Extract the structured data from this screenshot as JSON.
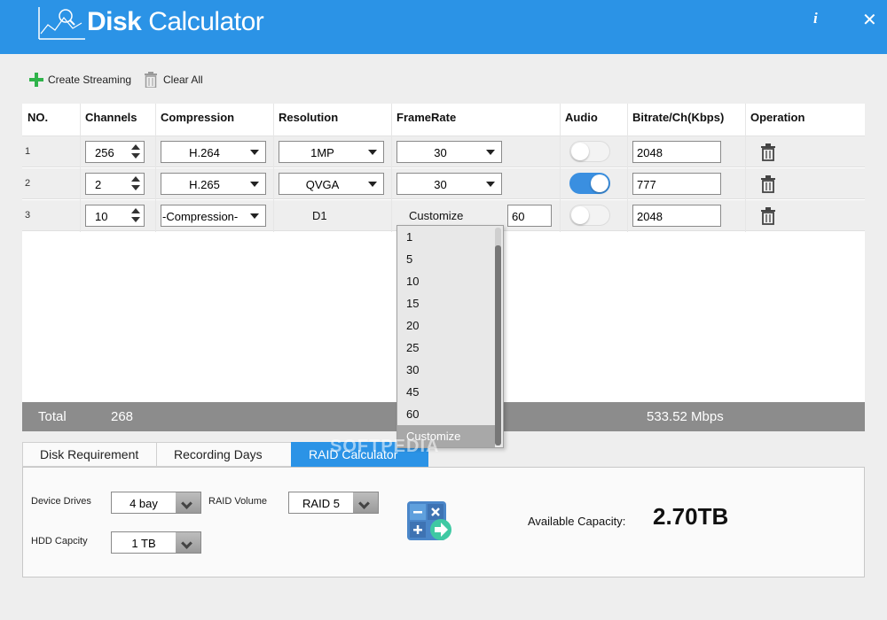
{
  "app": {
    "title_bold": "Disk",
    "title_rest": " Calculator",
    "info_glyph": "i",
    "close_glyph": "✕"
  },
  "toolbar": {
    "create_label": "Create Streaming",
    "clear_label": "Clear All"
  },
  "table": {
    "headers": [
      "NO.",
      "Channels",
      "Compression",
      "Resolution",
      "FrameRate",
      "Audio",
      "Bitrate/Ch(Kbps)",
      "Operation"
    ],
    "rows": [
      {
        "no": "1",
        "channels": "256",
        "compression": "H.264",
        "resolution": "1MP",
        "framerate": "30",
        "audio_on": false,
        "bitrate": "2048"
      },
      {
        "no": "2",
        "channels": "2",
        "compression": "H.265",
        "resolution": "QVGA",
        "framerate": "30",
        "audio_on": true,
        "bitrate": "777"
      },
      {
        "no": "3",
        "channels": "10",
        "compression": "-Compression-",
        "resolution": "D1",
        "framerate": "Customize",
        "framerate_custom": "60",
        "audio_on": false,
        "bitrate": "2048"
      }
    ]
  },
  "framerate_dropdown": {
    "options": [
      "1",
      "5",
      "10",
      "15",
      "20",
      "25",
      "30",
      "45",
      "60",
      "Customize"
    ],
    "selected": "Customize"
  },
  "total": {
    "label": "Total",
    "channels": "268",
    "bandwidth": "533.52 Mbps"
  },
  "tabs": [
    "Disk Requirement",
    "Recording Days",
    "RAID Calculator"
  ],
  "active_tab": "RAID Calculator",
  "raid": {
    "device_drives_label": "Device Drives",
    "device_drives_value": "4 bay",
    "raid_volume_label": "RAID Volume",
    "raid_volume_value": "RAID 5",
    "hdd_label": "HDD Capcity",
    "hdd_value": "1 TB",
    "capacity_label": "Available Capacity:",
    "capacity_value": "2.70TB"
  },
  "watermark": "SOFTPEDIA",
  "colors": {
    "accent": "#2b93e6",
    "total_bar": "#8c8c8c",
    "toggle_on": "#3a8fe0",
    "add_green": "#2fb34a"
  },
  "icons": [
    "logo-chart-icon",
    "info-icon",
    "close-icon",
    "plus-icon",
    "trash-icon",
    "calculator-icon"
  ]
}
